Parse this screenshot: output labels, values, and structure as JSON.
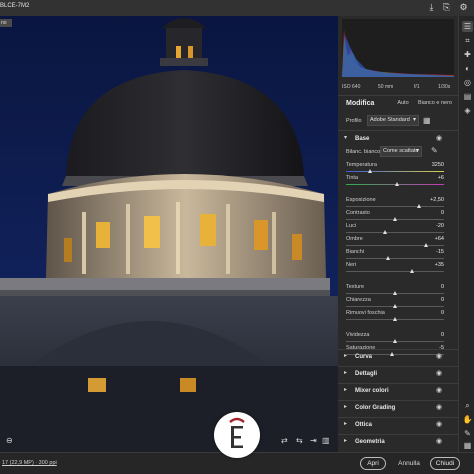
{
  "window": {
    "title": "BLCE-7M2",
    "tag": "no"
  },
  "histogram": {
    "exif": [
      "ISO 640",
      "50 mm",
      "f/1",
      "1/30s"
    ]
  },
  "edit": {
    "title": "Modifica",
    "auto_label": "Auto",
    "bw_label": "Bianco e nero",
    "profile_label": "Profilo",
    "profile_value": "Adobe Standard"
  },
  "base": {
    "title": "Base",
    "wb_label": "Bilanc. bianco",
    "wb_value": "Come scattato",
    "sliders": [
      {
        "label": "Temperatura",
        "value": "3250",
        "level": 0.25
      },
      {
        "label": "Tinta",
        "value": "+6",
        "level": 0.53
      },
      {
        "label": "Esposizione",
        "value": "+2,50",
        "level": 0.75
      },
      {
        "label": "Contrasto",
        "value": "0",
        "level": 0.5
      },
      {
        "label": "Luci",
        "value": "-20",
        "level": 0.4
      },
      {
        "label": "Ombre",
        "value": "+64",
        "level": 0.82
      },
      {
        "label": "Bianchi",
        "value": "-15",
        "level": 0.43
      },
      {
        "label": "Neri",
        "value": "+35",
        "level": 0.68
      },
      {
        "label": "Texture",
        "value": "0",
        "level": 0.5
      },
      {
        "label": "Chiarezza",
        "value": "0",
        "level": 0.5
      },
      {
        "label": "Rimuovi foschia",
        "value": "0",
        "level": 0.5
      },
      {
        "label": "Vividezza",
        "value": "0",
        "level": 0.5
      },
      {
        "label": "Saturazione",
        "value": "-5",
        "level": 0.47
      }
    ]
  },
  "sections": [
    "Curva",
    "Dettagli",
    "Mixer colori",
    "Color Grading",
    "Ottica",
    "Geometria"
  ],
  "footer": {
    "file_info": "17 (22,9 MP) · 300 ppi",
    "open_label": "Apri",
    "cancel_label": "Annulla",
    "done_label": "Chiudi"
  },
  "colors": {
    "panel_bg": "#2a2a2a",
    "sky": "#0c1a45",
    "window_glow": "#e8a531"
  }
}
